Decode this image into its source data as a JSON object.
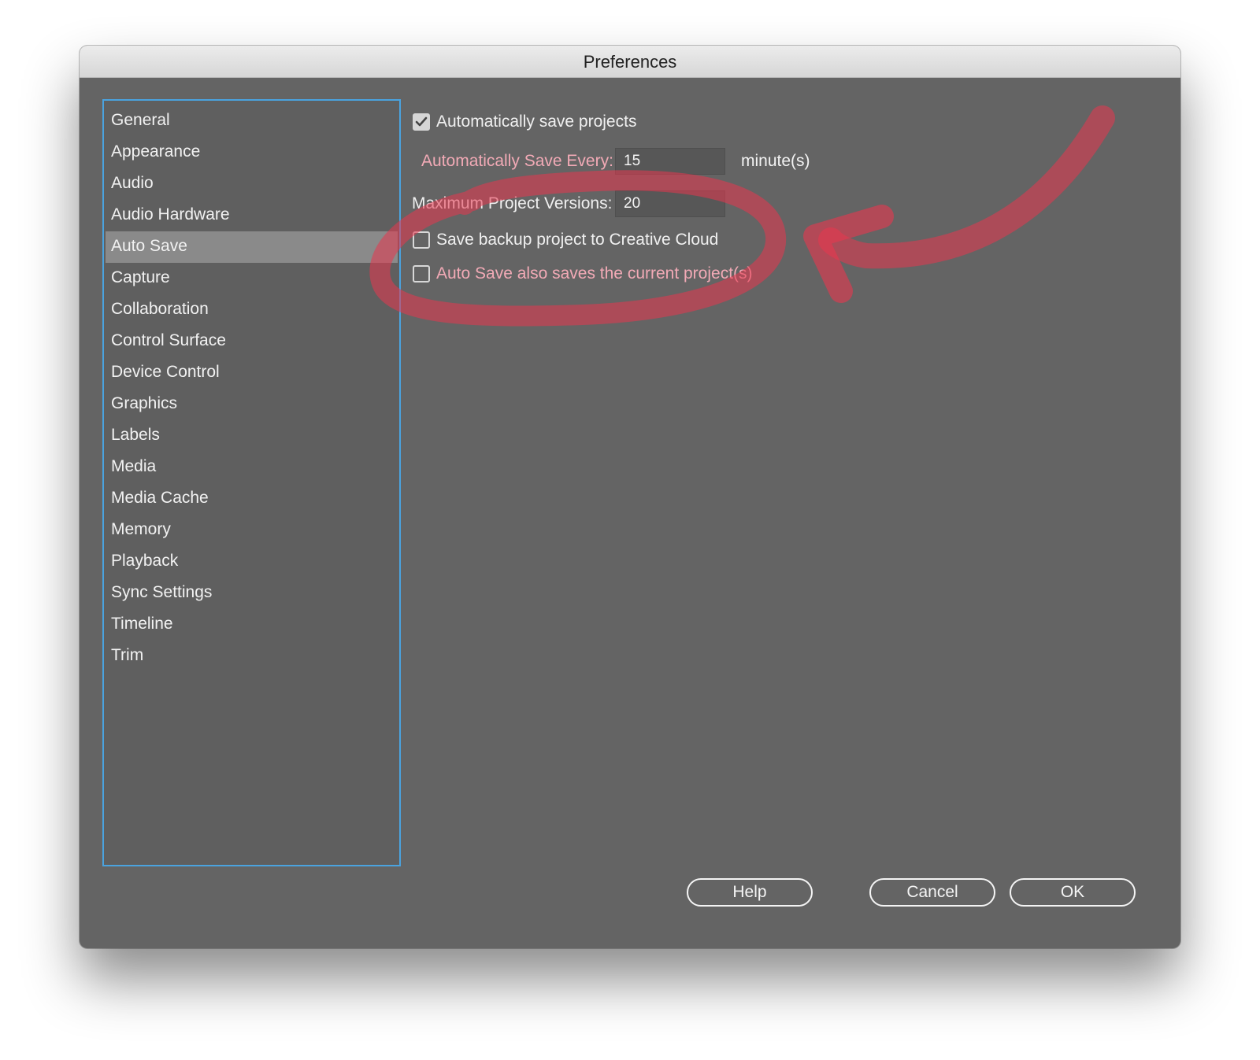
{
  "window": {
    "title": "Preferences"
  },
  "sidebar": {
    "items": [
      {
        "label": "General",
        "selected": false
      },
      {
        "label": "Appearance",
        "selected": false
      },
      {
        "label": "Audio",
        "selected": false
      },
      {
        "label": "Audio Hardware",
        "selected": false
      },
      {
        "label": "Auto Save",
        "selected": true
      },
      {
        "label": "Capture",
        "selected": false
      },
      {
        "label": "Collaboration",
        "selected": false
      },
      {
        "label": "Control Surface",
        "selected": false
      },
      {
        "label": "Device Control",
        "selected": false
      },
      {
        "label": "Graphics",
        "selected": false
      },
      {
        "label": "Labels",
        "selected": false
      },
      {
        "label": "Media",
        "selected": false
      },
      {
        "label": "Media Cache",
        "selected": false
      },
      {
        "label": "Memory",
        "selected": false
      },
      {
        "label": "Playback",
        "selected": false
      },
      {
        "label": "Sync Settings",
        "selected": false
      },
      {
        "label": "Timeline",
        "selected": false
      },
      {
        "label": "Trim",
        "selected": false
      }
    ]
  },
  "auto_save": {
    "auto_save_projects": {
      "label": "Automatically save projects",
      "checked": true
    },
    "save_every": {
      "label": "Automatically Save Every:",
      "value": "15",
      "unit": "minute(s)"
    },
    "max_versions": {
      "label": "Maximum Project Versions:",
      "value": "20"
    },
    "backup_cloud": {
      "label": "Save backup project to Creative Cloud",
      "checked": false
    },
    "saves_current": {
      "label": "Auto Save also saves the current project(s)",
      "checked": false
    }
  },
  "buttons": {
    "help": "Help",
    "cancel": "Cancel",
    "ok": "OK"
  },
  "annotation": {
    "color": "#e8374f",
    "shapes": [
      "circle",
      "arrow"
    ]
  },
  "colors": {
    "selection_border": "#4aa3df",
    "panel_bg": "#646464",
    "pink_label": "#f2aab6"
  }
}
